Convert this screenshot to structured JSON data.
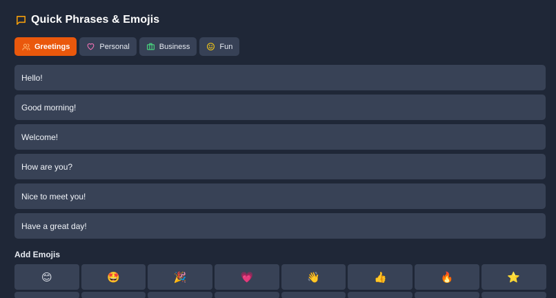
{
  "header": {
    "title": "Quick Phrases & Emojis",
    "icon": "chat-bubble-icon",
    "icon_color": "#f59e0b"
  },
  "tabs": [
    {
      "label": "Greetings",
      "icon": "users-icon",
      "icon_color": "#fdba74",
      "active": true
    },
    {
      "label": "Personal",
      "icon": "heart-icon",
      "icon_color": "#f472b6",
      "active": false
    },
    {
      "label": "Business",
      "icon": "briefcase-icon",
      "icon_color": "#4ade80",
      "active": false
    },
    {
      "label": "Fun",
      "icon": "smile-icon",
      "icon_color": "#facc15",
      "active": false
    }
  ],
  "phrases": [
    "Hello!",
    "Good morning!",
    "Welcome!",
    "How are you?",
    "Nice to meet you!",
    "Have a great day!"
  ],
  "emoji_section": {
    "label": "Add Emojis",
    "emojis": [
      "😊",
      "🤩",
      "🎉",
      "💗",
      "👋",
      "👍",
      "🔥",
      "⭐"
    ]
  },
  "colors": {
    "background": "#1f2737",
    "surface": "#384256",
    "accent": "#ea580c"
  }
}
